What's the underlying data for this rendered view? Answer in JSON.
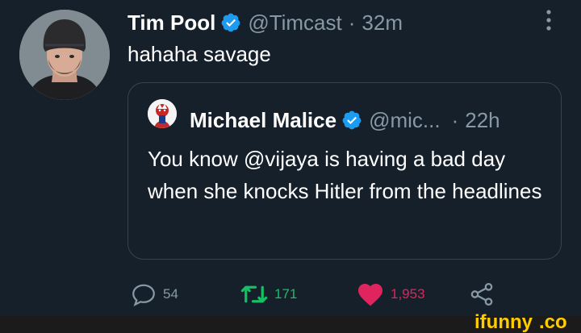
{
  "tweet": {
    "author_name": "Tim Pool",
    "author_handle": "@Timcast",
    "separator": "·",
    "time": "32m",
    "text": "hahaha savage"
  },
  "quoted_tweet": {
    "author_name": "Michael Malice",
    "author_handle": "@mic...",
    "separator": "·",
    "time": "22h",
    "text": "You know @vijaya is having a bad day when she knocks Hitler from the headlines"
  },
  "actions": {
    "replies": "54",
    "retweets": "171",
    "likes": "1,953"
  },
  "colors": {
    "background": "#15202b",
    "verified": "#1d9bf0",
    "retweet": "#17bf63",
    "like": "#e0245e",
    "muted": "#8899a6"
  },
  "icons": [
    "verified-badge-icon",
    "more-options-icon",
    "reply-icon",
    "retweet-icon",
    "like-heart-icon",
    "share-icon"
  ],
  "watermark": "ifunny.co"
}
